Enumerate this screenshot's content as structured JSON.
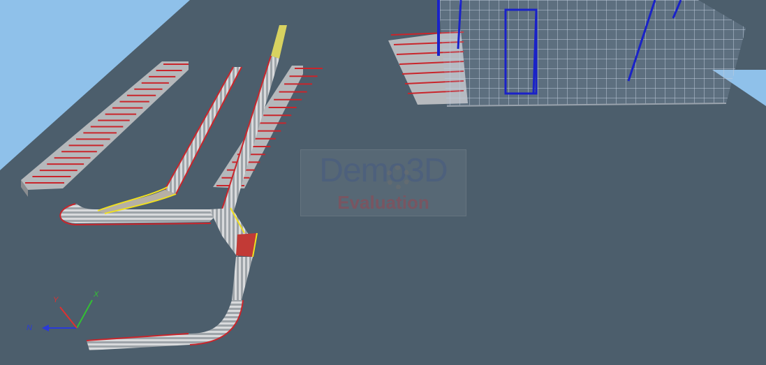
{
  "app": {
    "watermark_brand": "Demo3D",
    "watermark_label": "Evaluation"
  },
  "axes": {
    "x_label": "X",
    "y_label": "Y",
    "z_label": "N"
  },
  "colors": {
    "background": "#4c5e6c",
    "floor_edge": "#7fb7e6",
    "conveyor_rail": "#c9252b",
    "roller": "#b8b8b8",
    "highlight": "#f0e020",
    "rack_frame": "#c8d4e2",
    "rack_upright": "#1a22c8",
    "axis_x": "#33c033",
    "axis_y": "#e03030",
    "axis_z": "#2a3ad8"
  }
}
